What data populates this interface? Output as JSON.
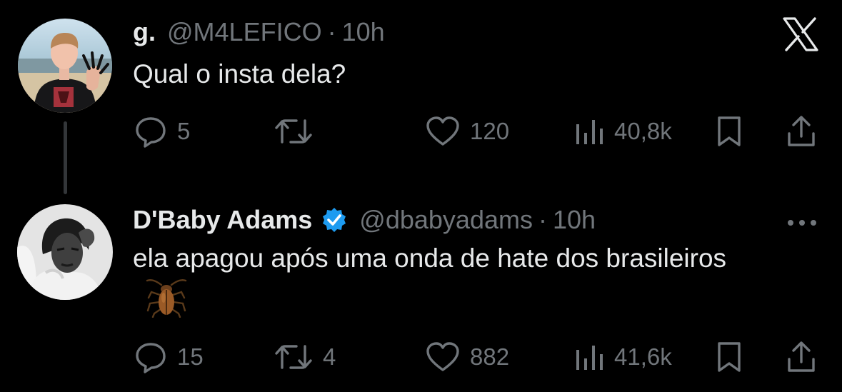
{
  "theme": {
    "background": "#000000",
    "text": "#e7e9ea",
    "muted": "#71767b",
    "verified_color": "#1d9bf0",
    "thread_line": "#333639"
  },
  "brand": {
    "icon": "x-logo-icon"
  },
  "tweets": [
    {
      "author_name": "g.",
      "handle": "@M4LEFICO",
      "separator": "·",
      "time": "10h",
      "verified": false,
      "text": "Qual o insta dela?",
      "emoji": "",
      "replies": "5",
      "retweets": "",
      "likes": "120",
      "views": "40,8k"
    },
    {
      "author_name": "D'Baby Adams",
      "handle": "@dbabyadams",
      "separator": "·",
      "time": "10h",
      "verified": true,
      "text": "ela apagou após uma onda de hate dos brasileiros",
      "emoji": "cockroach",
      "replies": "15",
      "retweets": "4",
      "likes": "882",
      "views": "41,6k"
    }
  ]
}
